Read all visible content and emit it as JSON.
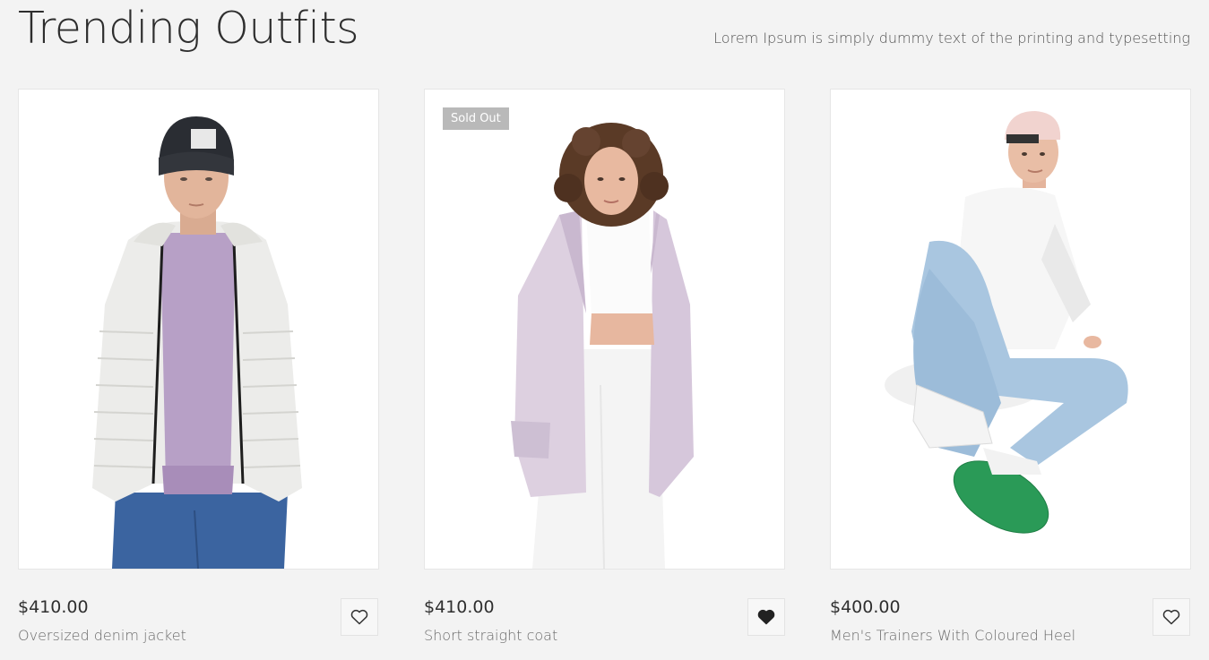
{
  "section": {
    "title": "Trending Outfits",
    "subtitle": "Lorem Ipsum is simply dummy text of the printing and typesetting"
  },
  "products": [
    {
      "price": "$410.00",
      "name": "Oversized denim jacket",
      "badge": "",
      "wishlisted": false,
      "image_icon": "man-in-white-puffer-jacket-photo"
    },
    {
      "price": "$410.00",
      "name": "Short straight coat",
      "badge": "Sold Out",
      "wishlisted": true,
      "image_icon": "woman-in-lilac-coat-photo"
    },
    {
      "price": "$400.00",
      "name": "Men's Trainers With Coloured Heel",
      "badge": "",
      "wishlisted": false,
      "image_icon": "seated-man-in-jeans-and-trainers-photo"
    }
  ],
  "icons": {
    "wishlist": "heart-icon"
  },
  "colors": {
    "background": "#f3f3f3",
    "badge": "#b9b9b9",
    "text": "#2b2b2b"
  }
}
